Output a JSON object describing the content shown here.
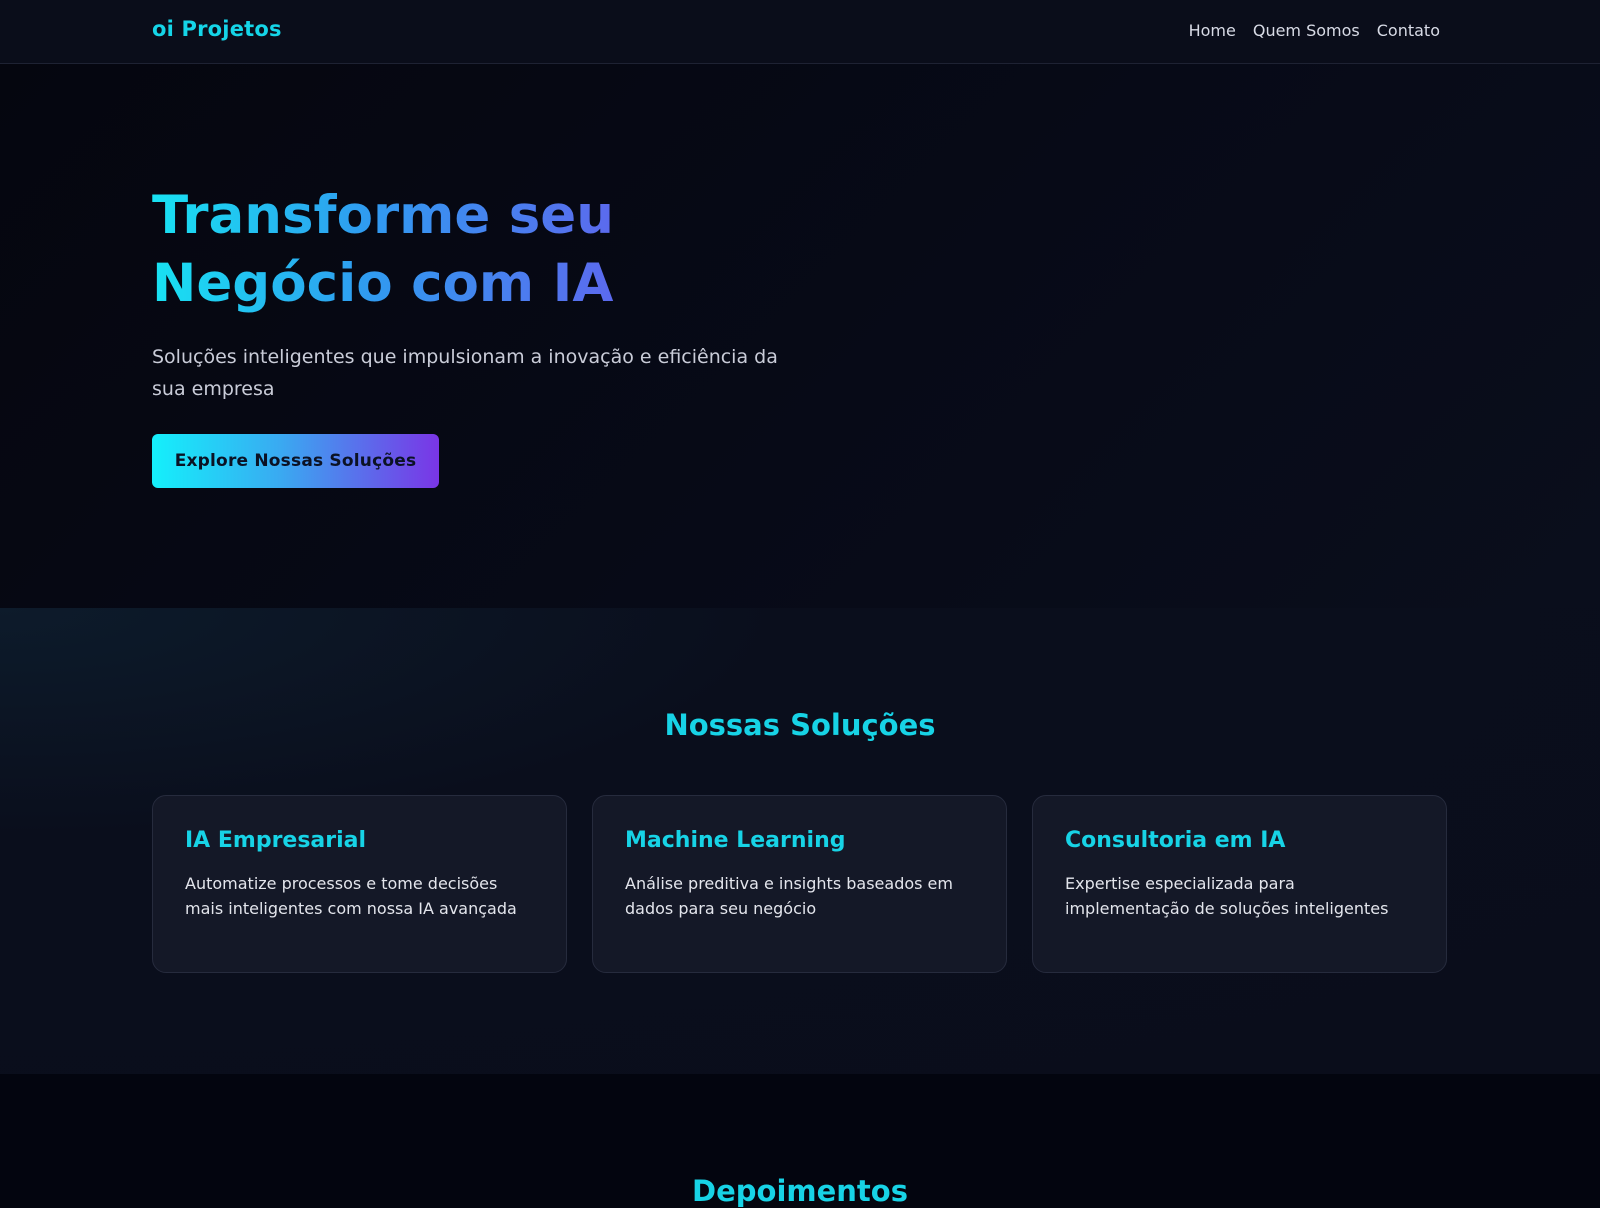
{
  "brand": {
    "logo": "oi Projetos"
  },
  "nav": {
    "items": [
      "Home",
      "Quem Somos",
      "Contato"
    ]
  },
  "hero": {
    "title": "Transforme seu Negócio com IA",
    "subtitle": "Soluções inteligentes que impulsionam a inovação e eficiência da sua empresa",
    "cta_label": "Explore Nossas Soluções"
  },
  "solutions": {
    "title": "Nossas Soluções",
    "cards": [
      {
        "title": "IA Empresarial",
        "text": "Automatize processos e tome decisões mais inteligentes com nossa IA avançada"
      },
      {
        "title": "Machine Learning",
        "text": "Análise preditiva e insights baseados em dados para seu negócio"
      },
      {
        "title": "Consultoria em IA",
        "text": "Expertise especializada para implementação de soluções inteligentes"
      }
    ]
  },
  "testimonials": {
    "title": "Depoimentos"
  },
  "colors": {
    "accent": "#17d3e6",
    "gradient_start": "#14f0fb",
    "gradient_end": "#7a35e6",
    "background": "#05070f"
  }
}
